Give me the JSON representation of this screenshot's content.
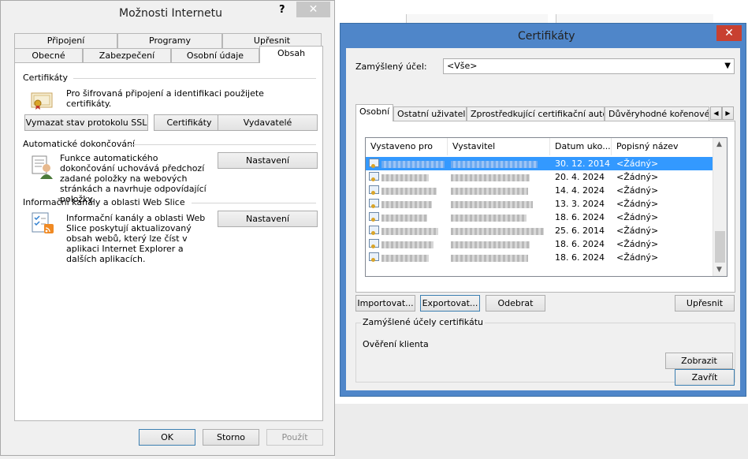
{
  "internet_options": {
    "title": "Možnosti Internetu",
    "help_glyph": "?",
    "close_glyph": "✕",
    "tabs_row1": [
      "Připojení",
      "Programy",
      "Upřesnit"
    ],
    "tabs_row2": [
      "Obecné",
      "Zabezpečení",
      "Osobní údaje",
      "Obsah"
    ],
    "certificates_section": {
      "label": "Certifikáty",
      "description": "Pro šifrovaná připojení a identifikaci použijete certifikáty.",
      "buttons": [
        "Vymazat stav protokolu SSL",
        "Certifikáty",
        "Vydavatelé"
      ]
    },
    "autocomplete_section": {
      "label": "Automatické dokončování",
      "description": "Funkce automatického dokončování uchovává předchozí zadané položky na webových stránkách a navrhuje odpovídající položky.",
      "button": "Nastavení"
    },
    "feeds_section": {
      "label": "Informační kanály a oblasti Web Slice",
      "description": "Informační kanály a oblasti Web Slice poskytují aktualizovaný obsah webů, který lze číst v aplikaci Internet Explorer a dalších aplikacích.",
      "button": "Nastavení"
    },
    "footer_buttons": [
      "OK",
      "Storno",
      "Použít"
    ]
  },
  "certificates": {
    "title": "Certifikáty",
    "close_glyph": "✕",
    "purpose_label": "Zamýšlený účel:",
    "purpose_value": "<Vše>",
    "tabs": [
      "Osobní",
      "Ostatní uživatelé",
      "Zprostředkující certifikační autority",
      "Důvěryhodné kořenové ce"
    ],
    "columns": [
      "Vystaveno pro",
      "Vystavitel",
      "Datum uko...",
      "Popisný název"
    ],
    "rows": [
      {
        "date": "30. 12. 2014",
        "name": "<Žádný>"
      },
      {
        "date": "20. 4. 2024",
        "name": "<Žádný>"
      },
      {
        "date": "14. 4. 2024",
        "name": "<Žádný>"
      },
      {
        "date": "13. 3. 2024",
        "name": "<Žádný>"
      },
      {
        "date": "18. 6. 2024",
        "name": "<Žádný>"
      },
      {
        "date": "25. 6. 2014",
        "name": "<Žádný>"
      },
      {
        "date": "18. 6. 2024",
        "name": "<Žádný>"
      },
      {
        "date": "18. 6. 2024",
        "name": "<Žádný>"
      }
    ],
    "action_buttons": [
      "Importovat...",
      "Exportovat...",
      "Odebrat",
      "Upřesnit"
    ],
    "purposes_group_label": "Zamýšlené účely certifikátu",
    "purposes_value": "Ověření klienta",
    "view_button": "Zobrazit",
    "close_button": "Zavřít"
  }
}
